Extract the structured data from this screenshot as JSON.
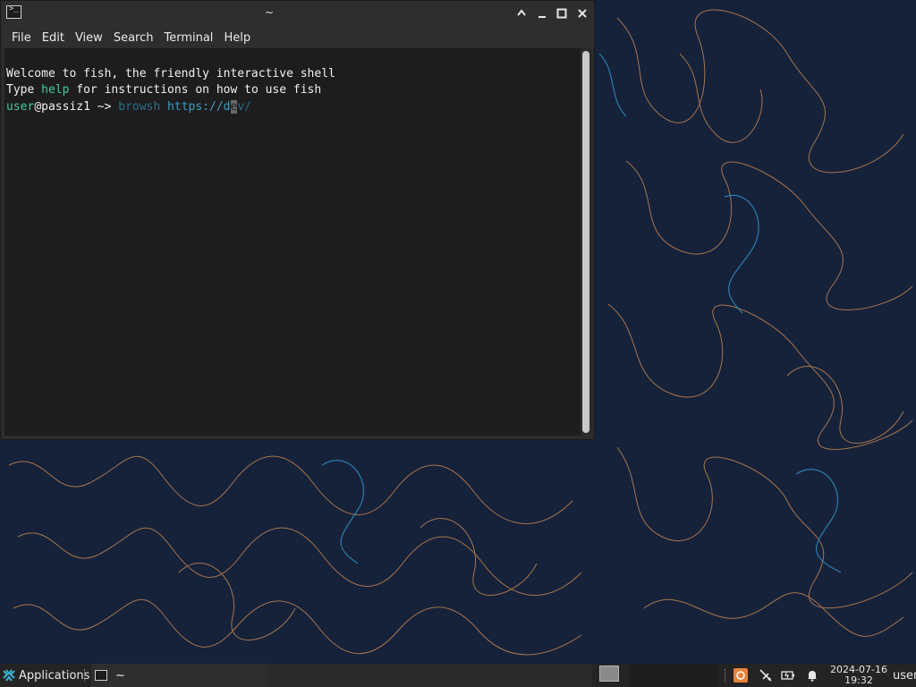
{
  "window": {
    "title": "~",
    "menu": [
      "File",
      "Edit",
      "View",
      "Search",
      "Terminal",
      "Help"
    ]
  },
  "terminal": {
    "line1": "Welcome to fish, the friendly interactive shell",
    "line2_pre": "Type ",
    "line2_cmd": "help",
    "line2_post": " for instructions on how to use fish",
    "prompt_user": "user",
    "prompt_host": "@passiz1",
    "prompt_sep": " ~> ",
    "cmd_word": "browsh",
    "cmd_space": " ",
    "cmd_url_a": "https://d",
    "cmd_cursor_char": "e",
    "cmd_url_b": "v/"
  },
  "taskbar": {
    "applications_label": "Applications",
    "task_label": "~",
    "clock_date": "2024-07-16",
    "clock_time": "19:32",
    "user_label": "user"
  },
  "colors": {
    "desktop": "#16223a",
    "contour_orange": "#c98a55",
    "contour_blue": "#2f86b8",
    "fish_green": "#46c9a4"
  }
}
